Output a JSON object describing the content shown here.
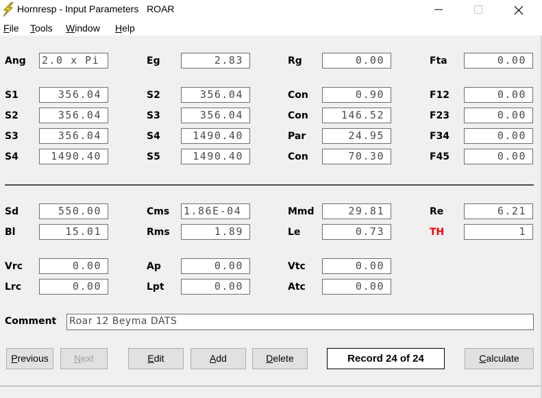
{
  "window": {
    "title": "Hornresp - Input Parameters   ROAR",
    "icon": "lightning-icon",
    "controls": [
      "minimize-icon",
      "maximize-icon",
      "close-icon"
    ]
  },
  "menu": [
    {
      "accel": "F",
      "rest": "ile"
    },
    {
      "accel": "T",
      "rest": "ools"
    },
    {
      "accel": "W",
      "rest": "indow"
    },
    {
      "accel": "H",
      "rest": "elp"
    }
  ],
  "params": {
    "ang": {
      "label": "Ang",
      "value": "2.0 x Pi"
    },
    "eg": {
      "label": "Eg",
      "value": "2.83"
    },
    "rg": {
      "label": "Rg",
      "value": "0.00"
    },
    "fta": {
      "label": "Fta",
      "value": "0.00"
    },
    "s1": {
      "label": "S1",
      "value": "356.04"
    },
    "s2a": {
      "label": "S2",
      "value": "356.04"
    },
    "con1": {
      "label": "Con",
      "value": "0.90"
    },
    "f12": {
      "label": "F12",
      "value": "0.00"
    },
    "s2b": {
      "label": "S2",
      "value": "356.04"
    },
    "s3a": {
      "label": "S3",
      "value": "356.04"
    },
    "con2": {
      "label": "Con",
      "value": "146.52"
    },
    "f23": {
      "label": "F23",
      "value": "0.00"
    },
    "s3b": {
      "label": "S3",
      "value": "356.04"
    },
    "s4a": {
      "label": "S4",
      "value": "1490.40"
    },
    "par": {
      "label": "Par",
      "value": "24.95"
    },
    "f34": {
      "label": "F34",
      "value": "0.00"
    },
    "s4b": {
      "label": "S4",
      "value": "1490.40"
    },
    "s5": {
      "label": "S5",
      "value": "1490.40"
    },
    "con3": {
      "label": "Con",
      "value": "70.30"
    },
    "f45": {
      "label": "F45",
      "value": "0.00"
    },
    "sd": {
      "label": "Sd",
      "value": "550.00"
    },
    "cms": {
      "label": "Cms",
      "value": "1.86E-04"
    },
    "mmd": {
      "label": "Mmd",
      "value": "29.81"
    },
    "re": {
      "label": "Re",
      "value": "6.21"
    },
    "bl": {
      "label": "Bl",
      "value": "15.01"
    },
    "rms": {
      "label": "Rms",
      "value": "1.89"
    },
    "le": {
      "label": "Le",
      "value": "0.73"
    },
    "th": {
      "label": "TH",
      "value": "1",
      "label_color": "#ff0000"
    },
    "vrc": {
      "label": "Vrc",
      "value": "0.00"
    },
    "ap": {
      "label": "Ap",
      "value": "0.00"
    },
    "vtc": {
      "label": "Vtc",
      "value": "0.00"
    },
    "lrc": {
      "label": "Lrc",
      "value": "0.00"
    },
    "lpt": {
      "label": "Lpt",
      "value": "0.00"
    },
    "atc": {
      "label": "Atc",
      "value": "0.00"
    }
  },
  "comment": {
    "label": "Comment",
    "value": "Roar 12 Beyma DATS"
  },
  "buttons": {
    "previous": {
      "accel": "P",
      "rest": "revious"
    },
    "next": {
      "accel": "N",
      "rest": "ext"
    },
    "edit": {
      "accel": "E",
      "rest": "dit"
    },
    "add": {
      "accel": "A",
      "rest": "dd"
    },
    "delete": {
      "accel": "D",
      "rest": "elete"
    },
    "calculate": {
      "accel": "C",
      "rest": "alculate"
    }
  },
  "record": "Record 24 of 24",
  "colors": {
    "accent_label": "#ff0000",
    "icon_yellow": "#f2d21b"
  }
}
